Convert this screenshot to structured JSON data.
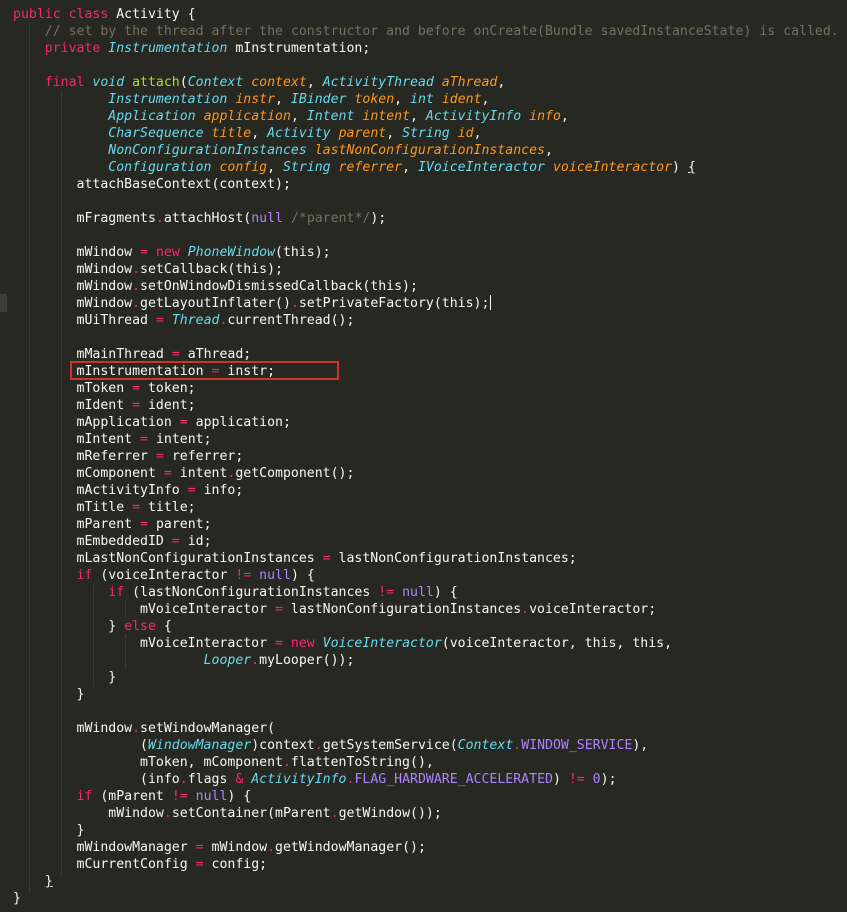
{
  "editor": {
    "theme": "monokai",
    "colors": {
      "background": "#272822",
      "text": "#f8f8f2",
      "keyword": "#f92672",
      "type": "#66d9ef",
      "parameter": "#fd971f",
      "function": "#a6e22e",
      "comment": "#75715e",
      "constant": "#ae81ff",
      "highlight_box": "#d0312d"
    },
    "highlighted_line": "mInstrumentation = instr;",
    "lines": [
      [
        [
          "kwc",
          "public class "
        ],
        [
          "",
          "Activity {"
        ]
      ],
      [
        [
          "",
          "    "
        ],
        [
          "cm",
          "// set by the thread after the constructor and before onCreate(Bundle savedInstanceState) is called."
        ]
      ],
      [
        [
          "",
          "    "
        ],
        [
          "kwc",
          "private "
        ],
        [
          "ty",
          "Instrumentation"
        ],
        [
          "",
          " mInstrumentation;"
        ]
      ],
      [],
      [
        [
          "",
          "    "
        ],
        [
          "kwc",
          "final "
        ],
        [
          "ty",
          "void "
        ],
        [
          "fn",
          "attach"
        ],
        [
          "",
          "("
        ],
        [
          "ty",
          "Context "
        ],
        [
          "pa",
          "context"
        ],
        [
          "",
          ", "
        ],
        [
          "ty",
          "ActivityThread "
        ],
        [
          "pa",
          "aThread"
        ],
        [
          "",
          ","
        ]
      ],
      [
        [
          "",
          "            "
        ],
        [
          "ty",
          "Instrumentation "
        ],
        [
          "pa",
          "instr"
        ],
        [
          "",
          ", "
        ],
        [
          "ty",
          "IBinder "
        ],
        [
          "pa",
          "token"
        ],
        [
          "",
          ", "
        ],
        [
          "ty",
          "int "
        ],
        [
          "pa",
          "ident"
        ],
        [
          "",
          ","
        ]
      ],
      [
        [
          "",
          "            "
        ],
        [
          "ty",
          "Application "
        ],
        [
          "pa",
          "application"
        ],
        [
          "",
          ", "
        ],
        [
          "ty",
          "Intent "
        ],
        [
          "pa",
          "intent"
        ],
        [
          "",
          ", "
        ],
        [
          "ty",
          "ActivityInfo "
        ],
        [
          "pa",
          "info"
        ],
        [
          "",
          ","
        ]
      ],
      [
        [
          "",
          "            "
        ],
        [
          "ty",
          "CharSequence "
        ],
        [
          "pa",
          "title"
        ],
        [
          "",
          ", "
        ],
        [
          "ty",
          "Activity "
        ],
        [
          "pa",
          "parent"
        ],
        [
          "",
          ", "
        ],
        [
          "ty",
          "String "
        ],
        [
          "pa",
          "id"
        ],
        [
          "",
          ","
        ]
      ],
      [
        [
          "",
          "            "
        ],
        [
          "ty",
          "NonConfigurationInstances "
        ],
        [
          "pa",
          "lastNonConfigurationInstances"
        ],
        [
          "",
          ","
        ]
      ],
      [
        [
          "",
          "            "
        ],
        [
          "ty",
          "Configuration "
        ],
        [
          "pa",
          "config"
        ],
        [
          "",
          ", "
        ],
        [
          "ty",
          "String "
        ],
        [
          "pa",
          "referrer"
        ],
        [
          "",
          ", "
        ],
        [
          "ty",
          "IVoiceInteractor "
        ],
        [
          "pa",
          "voiceInteractor"
        ],
        [
          "",
          ") "
        ],
        [
          "ul",
          "{"
        ]
      ],
      [
        [
          "",
          "        attachBaseContext(context);"
        ]
      ],
      [],
      [
        [
          "",
          "        mFragments"
        ],
        [
          "op",
          "."
        ],
        [
          "",
          "attachHost("
        ],
        [
          "nul",
          "null"
        ],
        [
          "",
          " "
        ],
        [
          "cm",
          "/*parent*/"
        ],
        [
          "",
          ");"
        ]
      ],
      [],
      [
        [
          "",
          "        mWindow "
        ],
        [
          "op",
          "= "
        ],
        [
          "kw",
          "new "
        ],
        [
          "ty",
          "PhoneWindow"
        ],
        [
          "",
          "(this);"
        ]
      ],
      [
        [
          "",
          "        mWindow"
        ],
        [
          "op",
          "."
        ],
        [
          "",
          "setCallback(this);"
        ]
      ],
      [
        [
          "",
          "        mWindow"
        ],
        [
          "op",
          "."
        ],
        [
          "",
          "setOnWindowDismissedCallback(this);"
        ]
      ],
      [
        [
          "",
          "        mWindow"
        ],
        [
          "op",
          "."
        ],
        [
          "",
          "getLayoutInflater()"
        ],
        [
          "op",
          "."
        ],
        [
          "",
          "setPrivateFactory(this);"
        ],
        [
          "caret",
          ""
        ]
      ],
      [
        [
          "",
          "        mUiThread "
        ],
        [
          "op",
          "= "
        ],
        [
          "ty",
          "Thread"
        ],
        [
          "op",
          "."
        ],
        [
          "",
          "currentThread();"
        ]
      ],
      [],
      [
        [
          "",
          "        mMainThread "
        ],
        [
          "op",
          "= "
        ],
        [
          "",
          "aThread;"
        ]
      ],
      [
        [
          "",
          "        mInstrumentation "
        ],
        [
          "op",
          "= "
        ],
        [
          "",
          "instr;"
        ]
      ],
      [
        [
          "",
          "        mToken "
        ],
        [
          "op",
          "= "
        ],
        [
          "",
          "token;"
        ]
      ],
      [
        [
          "",
          "        mIdent "
        ],
        [
          "op",
          "= "
        ],
        [
          "",
          "ident;"
        ]
      ],
      [
        [
          "",
          "        mApplication "
        ],
        [
          "op",
          "= "
        ],
        [
          "",
          "application;"
        ]
      ],
      [
        [
          "",
          "        mIntent "
        ],
        [
          "op",
          "= "
        ],
        [
          "",
          "intent;"
        ]
      ],
      [
        [
          "",
          "        mReferrer "
        ],
        [
          "op",
          "= "
        ],
        [
          "",
          "referrer;"
        ]
      ],
      [
        [
          "",
          "        mComponent "
        ],
        [
          "op",
          "= "
        ],
        [
          "",
          "intent"
        ],
        [
          "op",
          "."
        ],
        [
          "",
          "getComponent();"
        ]
      ],
      [
        [
          "",
          "        mActivityInfo "
        ],
        [
          "op",
          "= "
        ],
        [
          "",
          "info;"
        ]
      ],
      [
        [
          "",
          "        mTitle "
        ],
        [
          "op",
          "= "
        ],
        [
          "",
          "title;"
        ]
      ],
      [
        [
          "",
          "        mParent "
        ],
        [
          "op",
          "= "
        ],
        [
          "",
          "parent;"
        ]
      ],
      [
        [
          "",
          "        mEmbeddedID "
        ],
        [
          "op",
          "= "
        ],
        [
          "",
          "id;"
        ]
      ],
      [
        [
          "",
          "        mLastNonConfigurationInstances "
        ],
        [
          "op",
          "= "
        ],
        [
          "",
          "lastNonConfigurationInstances;"
        ]
      ],
      [
        [
          "",
          "        "
        ],
        [
          "kw",
          "if "
        ],
        [
          "",
          "(voiceInteractor "
        ],
        [
          "op",
          "!= "
        ],
        [
          "nul",
          "null"
        ],
        [
          "",
          ") {"
        ]
      ],
      [
        [
          "",
          "            "
        ],
        [
          "kw",
          "if "
        ],
        [
          "",
          "(lastNonConfigurationInstances "
        ],
        [
          "op",
          "!= "
        ],
        [
          "nul",
          "null"
        ],
        [
          "",
          ") {"
        ]
      ],
      [
        [
          "",
          "                mVoiceInteractor "
        ],
        [
          "op",
          "= "
        ],
        [
          "",
          "lastNonConfigurationInstances"
        ],
        [
          "op",
          "."
        ],
        [
          "",
          "voiceInteractor;"
        ]
      ],
      [
        [
          "",
          "            } "
        ],
        [
          "kw",
          "else "
        ],
        [
          "",
          "{"
        ]
      ],
      [
        [
          "",
          "                mVoiceInteractor "
        ],
        [
          "op",
          "= "
        ],
        [
          "kw",
          "new "
        ],
        [
          "ty",
          "VoiceInteractor"
        ],
        [
          "",
          "(voiceInteractor, this, this,"
        ]
      ],
      [
        [
          "",
          "                        "
        ],
        [
          "ty",
          "Looper"
        ],
        [
          "op",
          "."
        ],
        [
          "",
          "myLooper());"
        ]
      ],
      [
        [
          "",
          "            }"
        ]
      ],
      [
        [
          "",
          "        }"
        ]
      ],
      [],
      [
        [
          "",
          "        mWindow"
        ],
        [
          "op",
          "."
        ],
        [
          "",
          "setWindowManager("
        ]
      ],
      [
        [
          "",
          "                ("
        ],
        [
          "ty",
          "WindowManager"
        ],
        [
          "",
          ")context"
        ],
        [
          "op",
          "."
        ],
        [
          "",
          "getSystemService("
        ],
        [
          "ty",
          "Context"
        ],
        [
          "op",
          "."
        ],
        [
          "cst",
          "WINDOW_SERVICE"
        ],
        [
          "",
          "),"
        ]
      ],
      [
        [
          "",
          "                mToken, mComponent"
        ],
        [
          "op",
          "."
        ],
        [
          "",
          "flattenToString(),"
        ]
      ],
      [
        [
          "",
          "                (info"
        ],
        [
          "op",
          "."
        ],
        [
          "",
          "flags "
        ],
        [
          "op",
          "& "
        ],
        [
          "ty",
          "ActivityInfo"
        ],
        [
          "op",
          "."
        ],
        [
          "cst",
          "FLAG_HARDWARE_ACCELERATED"
        ],
        [
          "",
          ") "
        ],
        [
          "op",
          "!= "
        ],
        [
          "num",
          "0"
        ],
        [
          "",
          ");"
        ]
      ],
      [
        [
          "",
          "        "
        ],
        [
          "kw",
          "if "
        ],
        [
          "",
          "(mParent "
        ],
        [
          "op",
          "!= "
        ],
        [
          "nul",
          "null"
        ],
        [
          "",
          ") {"
        ]
      ],
      [
        [
          "",
          "            mWindow"
        ],
        [
          "op",
          "."
        ],
        [
          "",
          "setContainer(mParent"
        ],
        [
          "op",
          "."
        ],
        [
          "",
          "getWindow());"
        ]
      ],
      [
        [
          "",
          "        }"
        ]
      ],
      [
        [
          "",
          "        mWindowManager "
        ],
        [
          "op",
          "= "
        ],
        [
          "",
          "mWindow"
        ],
        [
          "op",
          "."
        ],
        [
          "",
          "getWindowManager();"
        ]
      ],
      [
        [
          "",
          "        mCurrentConfig "
        ],
        [
          "op",
          "= "
        ],
        [
          "",
          "config;"
        ]
      ],
      [
        [
          "",
          "    "
        ],
        [
          "ul",
          "}"
        ]
      ],
      [
        [
          "",
          "}"
        ]
      ]
    ]
  }
}
